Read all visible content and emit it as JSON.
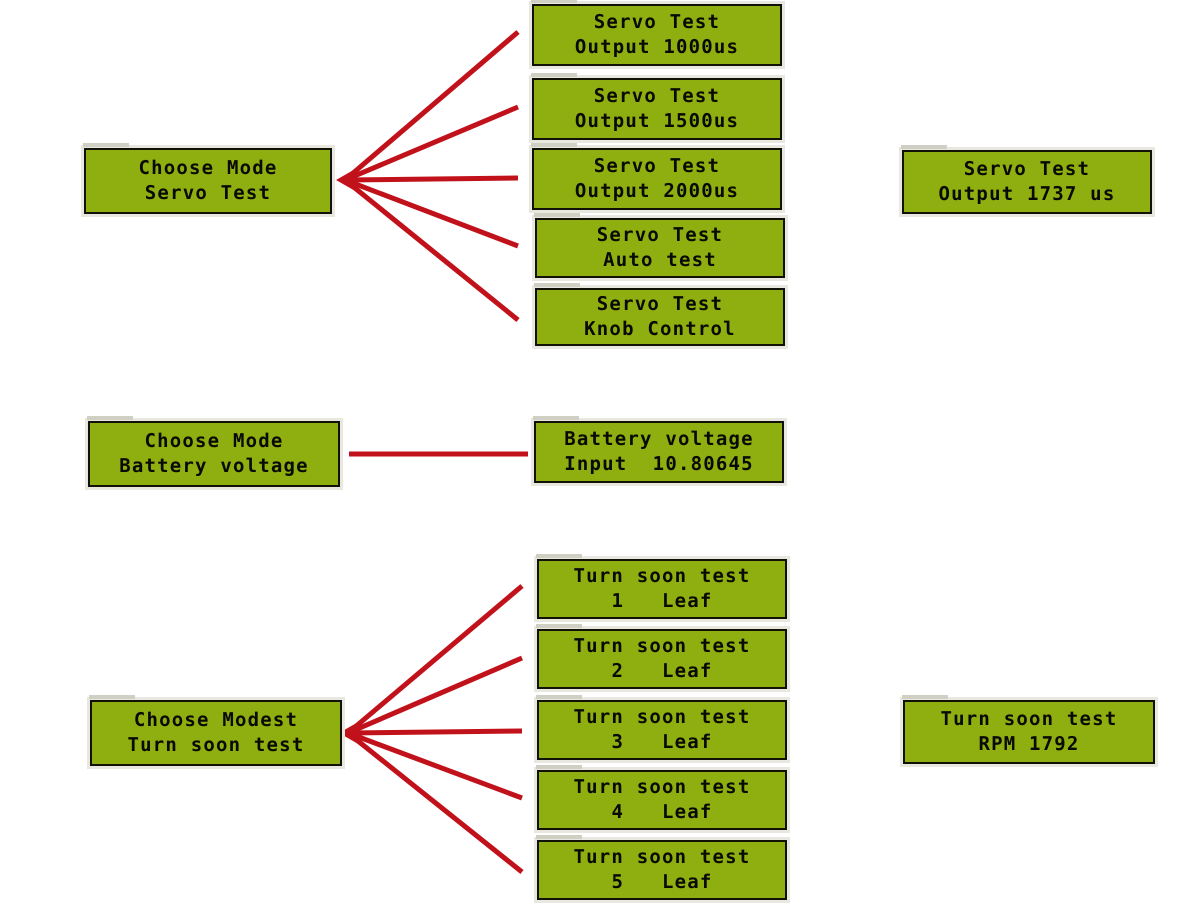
{
  "diagram": {
    "title": "LCD Menu Flow Diagram",
    "background_color": "#ffffff",
    "lcd_background_color": "#8fae0f",
    "lcd_text_color": "#0a0a05",
    "lcd_border_color": "#111108",
    "connector_color": "#c1121b"
  },
  "panels": {
    "servo_menu": {
      "line1": "Choose Mode",
      "line2": "Servo Test"
    },
    "servo_opt_1": {
      "line1": "Servo Test",
      "line2": "Output 1000us"
    },
    "servo_opt_2": {
      "line1": "Servo Test",
      "line2": "Output 1500us"
    },
    "servo_opt_3": {
      "line1": "Servo Test",
      "line2": "Output 2000us"
    },
    "servo_opt_4": {
      "line1": "Servo Test",
      "line2": "Auto test"
    },
    "servo_opt_5": {
      "line1": "Servo Test",
      "line2": "Knob Control"
    },
    "servo_result": {
      "line1": "Servo Test",
      "line2": "Output 1737 us"
    },
    "battery_menu": {
      "line1": "Choose Mode",
      "line2": "Battery voltage"
    },
    "battery_result": {
      "line1": "Battery voltage",
      "line2": "Input  10.80645"
    },
    "turn_menu": {
      "line1": "Choose Modest",
      "line2": "Turn soon test"
    },
    "turn_opt_1": {
      "line1": "Turn soon test",
      "line2": "1   Leaf"
    },
    "turn_opt_2": {
      "line1": "Turn soon test",
      "line2": "2   Leaf"
    },
    "turn_opt_3": {
      "line1": "Turn soon test",
      "line2": "3   Leaf"
    },
    "turn_opt_4": {
      "line1": "Turn soon test",
      "line2": "4   Leaf"
    },
    "turn_opt_5": {
      "line1": "Turn soon test",
      "line2": "5   Leaf"
    },
    "turn_result": {
      "line1": "Turn soon test",
      "line2": "RPM 1792"
    }
  }
}
